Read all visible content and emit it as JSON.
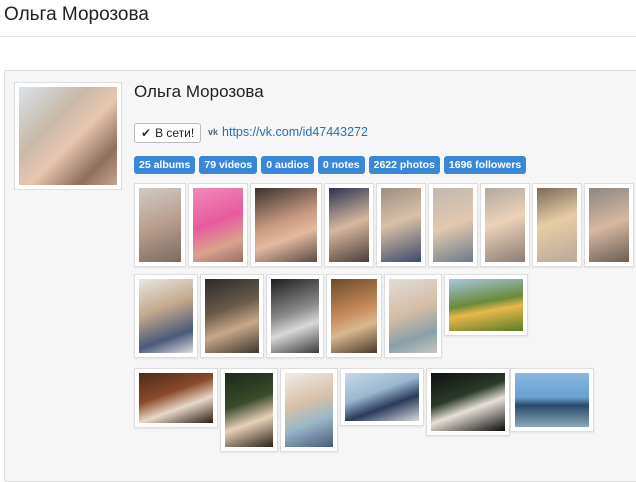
{
  "page": {
    "title": "Ольга Морозова"
  },
  "profile": {
    "name": "Ольга Морозова",
    "online_label": "В сети!",
    "vk_icon_text": "vk",
    "vk_link": "https://vk.com/id47443272"
  },
  "stats": [
    {
      "label": "25 albums"
    },
    {
      "label": "79 videos"
    },
    {
      "label": "0 audios"
    },
    {
      "label": "0 notes"
    },
    {
      "label": "2622 photos"
    },
    {
      "label": "1696 followers"
    }
  ],
  "colors": {
    "accent": "#3a87d8",
    "link": "#2a6db0"
  }
}
